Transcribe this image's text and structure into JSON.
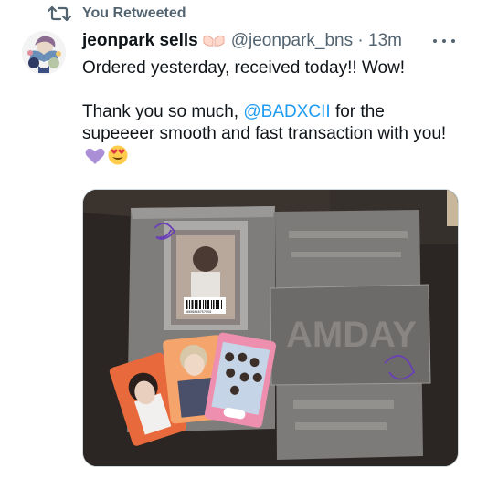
{
  "retweet": {
    "label": "You Retweeted",
    "icon": "retweet-icon"
  },
  "tweet": {
    "author_name": "jeonpark sells",
    "author_emoji": "palms-up-together-emoji",
    "handle": "@jeonpark_bns",
    "separator": "·",
    "time": "13m",
    "line1": "Ordered yesterday, received today!! Wow!",
    "line2_before": "Thank you so much, ",
    "mention": "@BADXCII",
    "line2_after": " for the supeeeer smooth and fast transaction with you!",
    "emojis": [
      "purple-heart-emoji",
      "smiling-face-with-heart-eyes-emoji"
    ],
    "media": {
      "description_icon": "photo",
      "barcode_text": "8809848757059",
      "box_text": "AMDAY"
    }
  },
  "colors": {
    "text": "#0f1419",
    "secondary": "#536471",
    "link": "#1d9bf0",
    "border": "#cfd9de"
  }
}
